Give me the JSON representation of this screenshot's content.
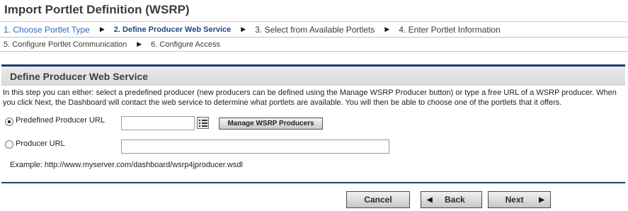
{
  "page": {
    "title": "Import Portlet Definition (WSRP)"
  },
  "steps": {
    "step1": "1. Choose Portlet Type",
    "step2": "2. Define Producer Web Service",
    "step3": "3. Select from Available Portlets",
    "step4": "4. Enter Portlet Information",
    "step5": "5. Configure Portlet Communication",
    "step6": "6. Configure Access",
    "separator": "▶"
  },
  "section": {
    "title": "Define Producer Web Service",
    "intro": "In this step you can either: select a predefined producer (new producers can be defined using the Manage WSRP Producer button) or type a free URL of a WSRP producer. When you click Next, the Dashboard will contact the web service to determine what portlets are available. You will then be able to choose one of the portlets that it offers."
  },
  "form": {
    "predefined_label": "Predefined Producer URL",
    "predefined_value": "",
    "predefined_selected": true,
    "manage_button": "Manage WSRP Producers",
    "producer_label": "Producer URL",
    "producer_value": "",
    "producer_selected": false,
    "example": "Example: http://www.myserver.com/dashboard/wsrp4jproducer.wsdl"
  },
  "buttons": {
    "cancel": "Cancel",
    "back": "Back",
    "next": "Next",
    "back_arrow": "◀",
    "next_arrow": "▶"
  },
  "colors": {
    "accent": "#1c3f6e",
    "link": "#2a6ebb",
    "current_step": "#1f4a85"
  },
  "icons": {
    "list_picker": "list-icon"
  }
}
